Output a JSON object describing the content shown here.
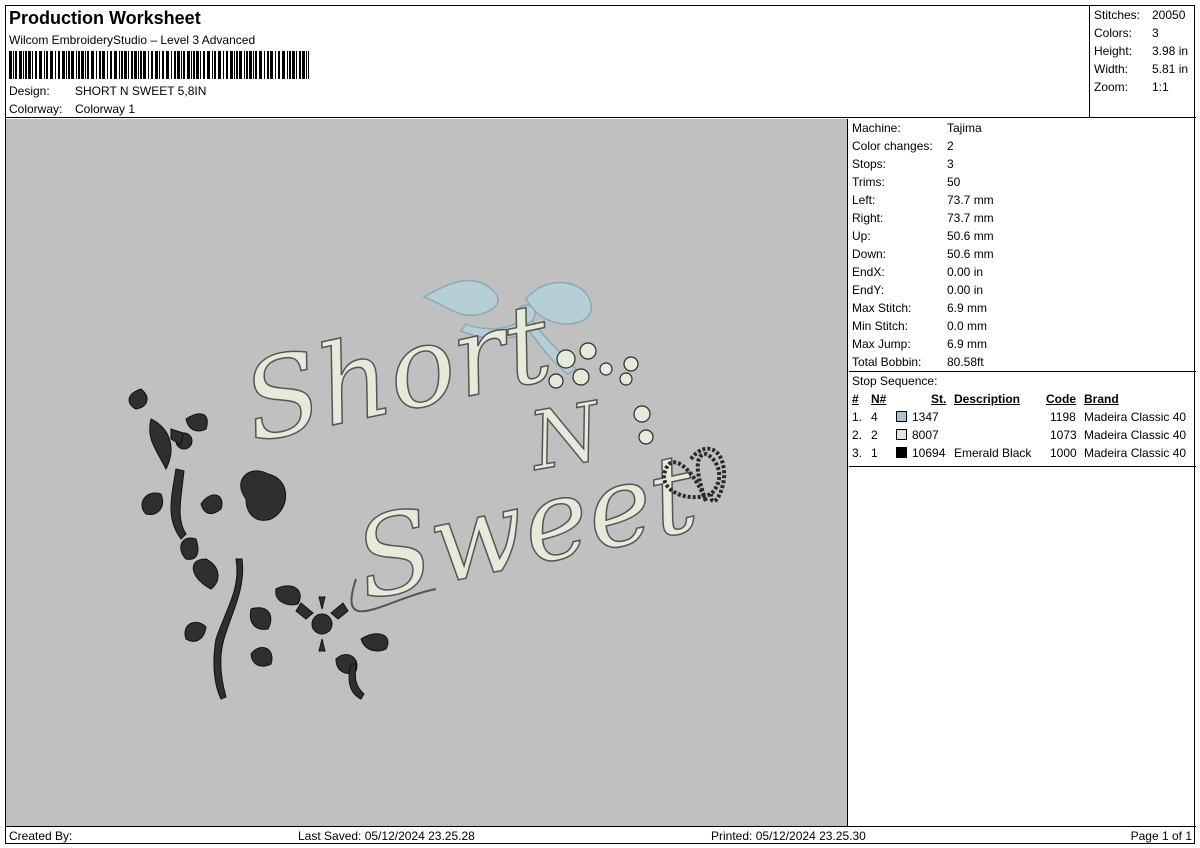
{
  "header": {
    "title": "Production Worksheet",
    "software": "Wilcom EmbroideryStudio – Level 3 Advanced",
    "design_label": "Design:",
    "design_value": "SHORT N SWEET 5,8IN",
    "colorway_label": "Colorway:",
    "colorway_value": "Colorway 1"
  },
  "summary": [
    {
      "label": "Stitches:",
      "value": "20050"
    },
    {
      "label": "Colors:",
      "value": "3"
    },
    {
      "label": "Height:",
      "value": "3.98 in"
    },
    {
      "label": "Width:",
      "value": "5.81 in"
    },
    {
      "label": "Zoom:",
      "value": "1:1"
    }
  ],
  "specs": [
    {
      "label": "Machine:",
      "value": "Tajima"
    },
    {
      "label": "Color changes:",
      "value": "2"
    },
    {
      "label": "Stops:",
      "value": "3"
    },
    {
      "label": "Trims:",
      "value": "50"
    },
    {
      "label": "Left:",
      "value": "73.7 mm"
    },
    {
      "label": "Right:",
      "value": "73.7 mm"
    },
    {
      "label": "Up:",
      "value": "50.6 mm"
    },
    {
      "label": "Down:",
      "value": "50.6 mm"
    },
    {
      "label": "EndX:",
      "value": "0.00 in"
    },
    {
      "label": "EndY:",
      "value": "0.00 in"
    },
    {
      "label": "Max Stitch:",
      "value": "6.9 mm"
    },
    {
      "label": "Min Stitch:",
      "value": "0.0 mm"
    },
    {
      "label": "Max Jump:",
      "value": "6.9 mm"
    },
    {
      "label": "Total Bobbin:",
      "value": "80.58ft"
    }
  ],
  "stop_sequence": {
    "title": "Stop Sequence:",
    "columns": {
      "num": "#",
      "n": "N#",
      "st": "St.",
      "description": "Description",
      "code": "Code",
      "brand": "Brand"
    },
    "rows": [
      {
        "num": "1.",
        "n": "4",
        "color": "#a9c4d0",
        "st": "1347",
        "description": "",
        "code": "1198",
        "brand": "Madeira Classic 40"
      },
      {
        "num": "2.",
        "n": "2",
        "color": "#dfe6d8",
        "st": "8007",
        "description": "",
        "code": "1073",
        "brand": "Madeira Classic 40"
      },
      {
        "num": "3.",
        "n": "1",
        "color": "#000000",
        "st": "10694",
        "description": "Emerald Black",
        "code": "1000",
        "brand": "Madeira Classic 40"
      }
    ]
  },
  "design_text": {
    "line1": "Short",
    "line2": "N",
    "line3": "Sweet"
  },
  "colors": {
    "preview_bg": "#c0c0c0",
    "thread_cream": "#e4ebd9",
    "thread_blue": "#b5cfd6",
    "thread_black": "#2a2a2a"
  },
  "footer": {
    "created_by": "Created By:",
    "last_saved": "Last Saved: 05/12/2024 23.25.28",
    "printed": "Printed: 05/12/2024 23.25.30",
    "page": "Page 1 of 1"
  }
}
